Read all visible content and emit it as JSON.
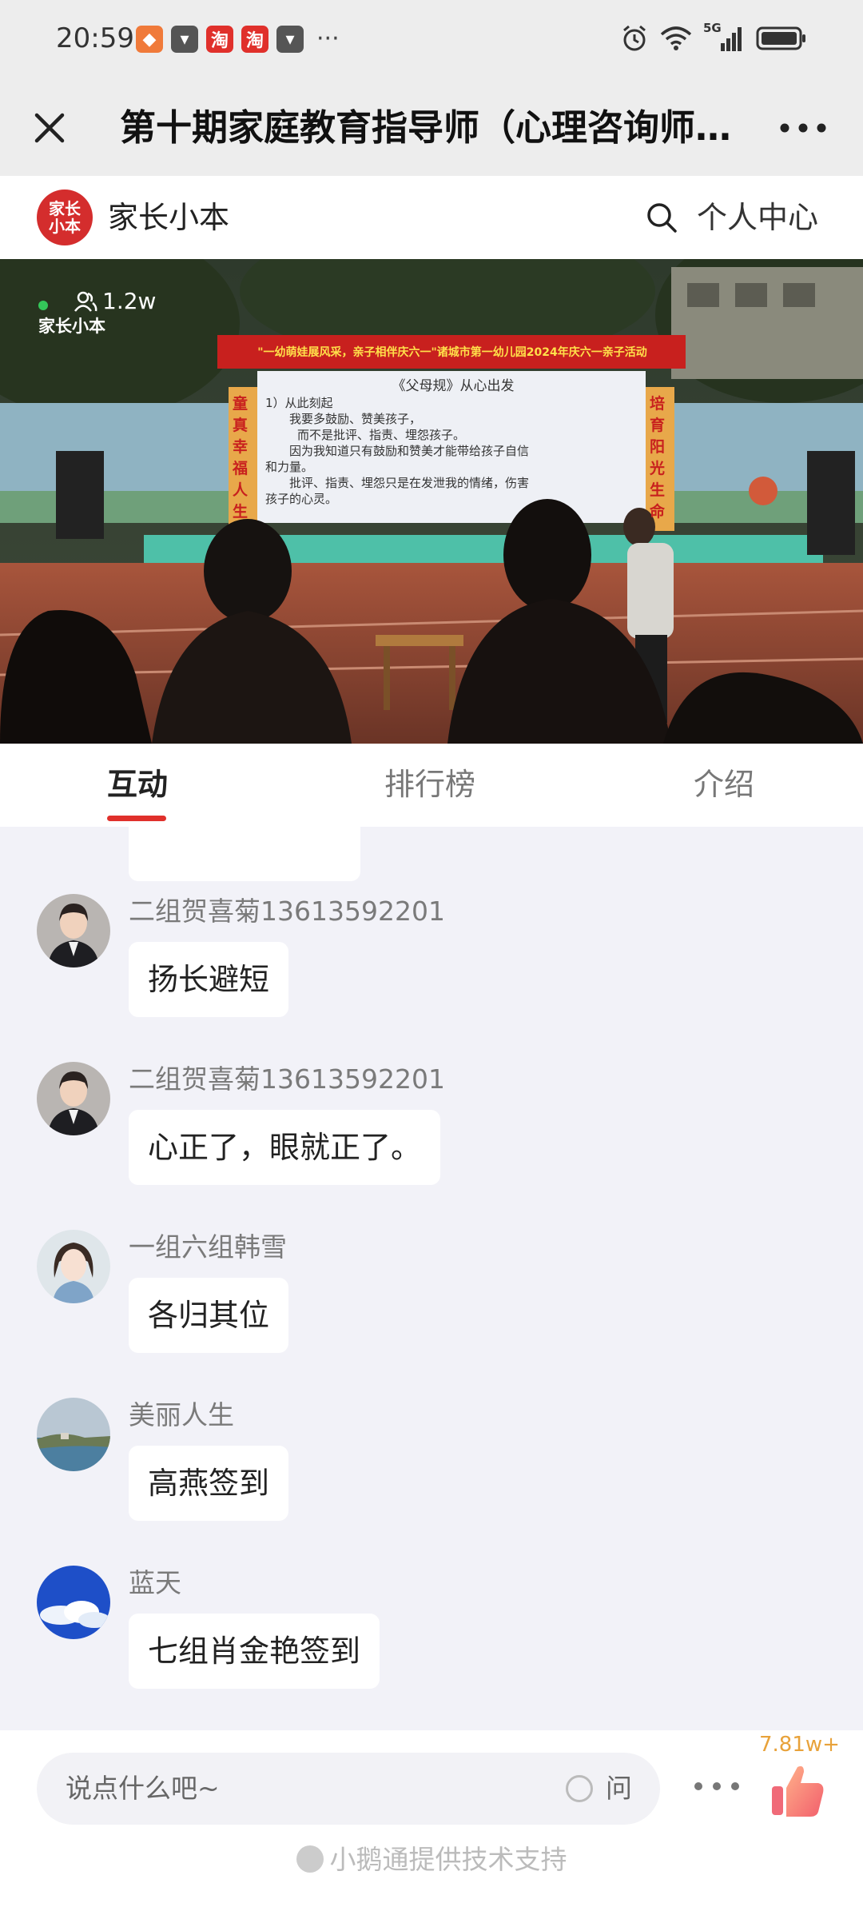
{
  "status_bar": {
    "time": "20:59",
    "app_icons": [
      {
        "name": "taobao-coupon-icon",
        "glyph": "◆",
        "color": "#f07a3a"
      },
      {
        "name": "app-icon",
        "glyph": "▾",
        "color": "#555555"
      },
      {
        "name": "taobao-icon",
        "glyph": "淘",
        "color": "#e0302b"
      },
      {
        "name": "taobao-icon",
        "glyph": "淘",
        "color": "#e0302b"
      },
      {
        "name": "app-icon",
        "glyph": "▾",
        "color": "#555555"
      }
    ],
    "more": "···",
    "network": "5G"
  },
  "title_bar": {
    "title": "第十期家庭教育指导师（心理咨询师…"
  },
  "brand": {
    "logo_text": "家长小本",
    "name": "家长小本",
    "personal_center": "个人中心"
  },
  "video": {
    "viewer_count": "1.2w",
    "watermark": "家长小本",
    "banner": "\"一幼萌娃展风采，亲子相伴庆六一\"诸城市第一幼儿园2024年庆六一亲子活动",
    "screen_heading": "《父母规》从心出发",
    "screen_lines": [
      "1）从此刻起",
      "我要多鼓励、赞美孩子，",
      "而不是批评、指责、埋怨孩子。",
      "因为我知道只有鼓励和赞美才能带给孩子自信",
      "和力量。",
      "批评、指责、埋怨只是在发泄我的情绪，伤害",
      "孩子的心灵。"
    ],
    "left_pillar": "童真幸福人生",
    "right_pillar": "培育阳光生命"
  },
  "tabs": [
    {
      "label": "互动",
      "active": true
    },
    {
      "label": "排行榜",
      "active": false
    },
    {
      "label": "介绍",
      "active": false
    }
  ],
  "messages": [
    {
      "name": "二组贺喜菊13613592201",
      "text": "扬长避短",
      "avatar": "woman-suit"
    },
    {
      "name": "二组贺喜菊13613592201",
      "text": "心正了，眼就正了。",
      "avatar": "woman-suit"
    },
    {
      "name": "一组六组韩雪",
      "text": "各归其位",
      "avatar": "girl-portrait"
    },
    {
      "name": "美丽人生",
      "text": "高燕签到",
      "avatar": "seaside"
    },
    {
      "name": "蓝天",
      "text": "七组肖金艳签到",
      "avatar": "blue-sky"
    }
  ],
  "bottom": {
    "input_placeholder": "说点什么吧~",
    "ask_label": "问",
    "like_count": "7.81w+",
    "powered_by": "小鹅通提供技术支持"
  },
  "colors": {
    "accent": "#e0302b",
    "like": "#e8a23a",
    "live": "#34c759"
  }
}
